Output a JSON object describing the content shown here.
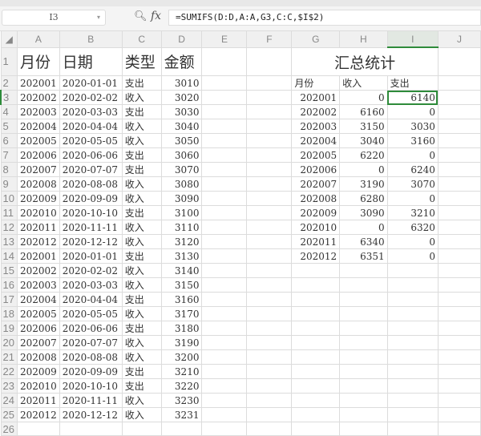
{
  "name_box": "I3",
  "formula": "=SUMIFS(D:D,A:A,G3,C:C,$I$2)",
  "columns": [
    "A",
    "B",
    "C",
    "D",
    "E",
    "F",
    "G",
    "H",
    "I",
    "J"
  ],
  "headers": {
    "month": "月份",
    "date": "日期",
    "type": "类型",
    "amount": "金额",
    "summary_title": "汇总统计"
  },
  "summary_headers": [
    "月份",
    "收入",
    "支出"
  ],
  "records": [
    [
      "202001",
      "2020-01-01",
      "支出",
      "3010"
    ],
    [
      "202002",
      "2020-02-02",
      "收入",
      "3020"
    ],
    [
      "202003",
      "2020-03-03",
      "支出",
      "3030"
    ],
    [
      "202004",
      "2020-04-04",
      "收入",
      "3040"
    ],
    [
      "202005",
      "2020-05-05",
      "收入",
      "3050"
    ],
    [
      "202006",
      "2020-06-06",
      "支出",
      "3060"
    ],
    [
      "202007",
      "2020-07-07",
      "支出",
      "3070"
    ],
    [
      "202008",
      "2020-08-08",
      "收入",
      "3080"
    ],
    [
      "202009",
      "2020-09-09",
      "收入",
      "3090"
    ],
    [
      "202010",
      "2020-10-10",
      "支出",
      "3100"
    ],
    [
      "202011",
      "2020-11-11",
      "收入",
      "3110"
    ],
    [
      "202012",
      "2020-12-12",
      "收入",
      "3120"
    ],
    [
      "202001",
      "2020-01-01",
      "支出",
      "3130"
    ],
    [
      "202002",
      "2020-02-02",
      "收入",
      "3140"
    ],
    [
      "202003",
      "2020-03-03",
      "收入",
      "3150"
    ],
    [
      "202004",
      "2020-04-04",
      "支出",
      "3160"
    ],
    [
      "202005",
      "2020-05-05",
      "收入",
      "3170"
    ],
    [
      "202006",
      "2020-06-06",
      "支出",
      "3180"
    ],
    [
      "202007",
      "2020-07-07",
      "收入",
      "3190"
    ],
    [
      "202008",
      "2020-08-08",
      "收入",
      "3200"
    ],
    [
      "202009",
      "2020-09-09",
      "支出",
      "3210"
    ],
    [
      "202010",
      "2020-10-10",
      "支出",
      "3220"
    ],
    [
      "202011",
      "2020-11-11",
      "收入",
      "3230"
    ],
    [
      "202012",
      "2020-12-12",
      "收入",
      "3231"
    ]
  ],
  "summary": [
    [
      "202001",
      "0",
      "6140"
    ],
    [
      "202002",
      "6160",
      "0"
    ],
    [
      "202003",
      "3150",
      "3030"
    ],
    [
      "202004",
      "3040",
      "3160"
    ],
    [
      "202005",
      "6220",
      "0"
    ],
    [
      "202006",
      "0",
      "6240"
    ],
    [
      "202007",
      "3190",
      "3070"
    ],
    [
      "202008",
      "6280",
      "0"
    ],
    [
      "202009",
      "3090",
      "3210"
    ],
    [
      "202010",
      "0",
      "6320"
    ],
    [
      "202011",
      "6340",
      "0"
    ],
    [
      "202012",
      "6351",
      "0"
    ]
  ]
}
